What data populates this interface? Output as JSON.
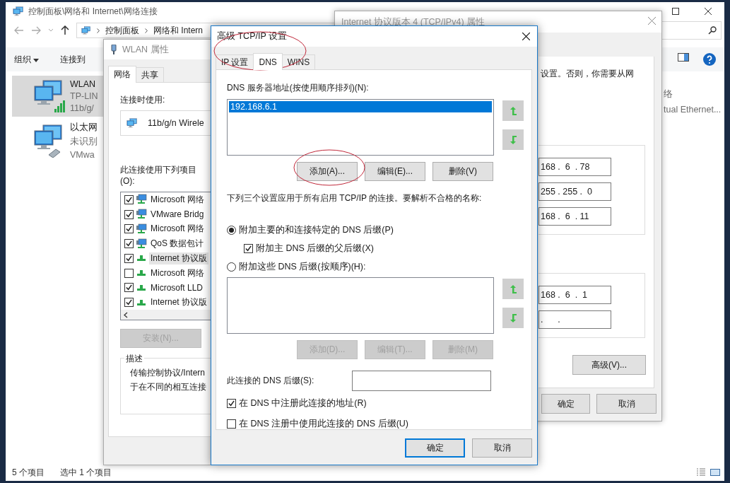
{
  "explorer": {
    "title": "控制面板\\网络和 Internet\\网络连接",
    "breadcrumb": [
      "控制面板",
      "网络和 Intern"
    ],
    "toolbar": [
      {
        "label": "组织",
        "dropdown": true
      },
      {
        "label": "连接到",
        "dropdown": false
      }
    ],
    "connections": [
      {
        "kind": "wireless",
        "selected": true,
        "lines": [
          "WLAN",
          "TP-LIN",
          "11b/g/"
        ]
      },
      {
        "kind": "wired",
        "selected": false,
        "lines": [
          "以太网",
          "未识别",
          "VMwa"
        ]
      }
    ],
    "partial_item": [
      "络",
      "tual Ethernet..."
    ],
    "status_bar": [
      "5 个项目",
      "选中 1 个项目"
    ]
  },
  "ipv4_window": {
    "title": "Internet 协议版本 4 (TCP/IPv4) 属性",
    "note": "设置。否则，你需要从网",
    "address_fields": [
      "168 .  6  . 78",
      "255 . 255 .  0",
      "168 .  6  . 11"
    ],
    "dns_fields": [
      "168 .  6  .  1",
      ".      ."
    ],
    "advanced_button": "高级(V)...",
    "buttons": [
      "确定",
      "取消"
    ]
  },
  "wlan_window": {
    "title": "WLAN 属性",
    "tabs": [
      {
        "label": "网络",
        "selected": true
      },
      {
        "label": "共享",
        "selected": false
      }
    ],
    "connect_using_label": "连接时使用:",
    "adapter": "11b/g/n  Wirele",
    "items_label": "此连接使用下列项目(O):",
    "items": [
      {
        "kind": "client",
        "label": "Microsoft 网络",
        "checked": true,
        "selected": false
      },
      {
        "kind": "client",
        "label": "VMware Bridg",
        "checked": true,
        "selected": false
      },
      {
        "kind": "client",
        "label": "Microsoft 网络",
        "checked": true,
        "selected": false
      },
      {
        "kind": "client",
        "label": "QoS 数据包计",
        "checked": true,
        "selected": false
      },
      {
        "kind": "protocol",
        "label": "Internet 协议版",
        "checked": true,
        "selected": true
      },
      {
        "kind": "protocol",
        "label": "Microsoft 网络",
        "checked": false,
        "selected": false
      },
      {
        "kind": "protocol",
        "label": "Microsoft LLD",
        "checked": true,
        "selected": false
      },
      {
        "kind": "protocol",
        "label": "Internet 协议版",
        "checked": true,
        "selected": false
      }
    ],
    "install_button": {
      "label": "安装(N)...",
      "disabled": true
    },
    "description_title": "描述",
    "description_lines": [
      "传输控制协议/Intern",
      "于在不同的相互连接"
    ]
  },
  "advanced_dialog": {
    "title": "高级 TCP/IP 设置",
    "tabs": [
      {
        "label": "IP 设置",
        "selected": false
      },
      {
        "label": "DNS",
        "selected": true
      },
      {
        "label": "WINS",
        "selected": false
      }
    ],
    "servers_label": "DNS 服务器地址(按使用顺序排列)(N):",
    "servers": [
      {
        "address": "192.168.6.1",
        "selected": true
      }
    ],
    "server_buttons": [
      {
        "label": "添加(A)...",
        "disabled": false
      },
      {
        "label": "编辑(E)...",
        "disabled": false
      },
      {
        "label": "删除(V)",
        "disabled": false
      }
    ],
    "info": "下列三个设置应用于所有启用 TCP/IP 的连接。要解析不合格的名称:",
    "suffix_options": [
      {
        "label": "附加主要的和连接特定的 DNS 后缀(P)",
        "selected": true
      },
      {
        "label": "附加这些 DNS 后缀(按顺序)(H):",
        "selected": false
      }
    ],
    "parent_suffix": {
      "label": "附加主 DNS 后缀的父后缀(X)",
      "checked": true
    },
    "suffix_buttons": [
      {
        "label": "添加(D)...",
        "disabled": true
      },
      {
        "label": "编辑(T)...",
        "disabled": true
      },
      {
        "label": "删除(M)",
        "disabled": true
      }
    ],
    "connection_suffix_label": "此连接的 DNS 后缀(S):",
    "register_options": [
      {
        "label": "在 DNS 中注册此连接的地址(R)",
        "checked": true
      },
      {
        "label": "在 DNS 注册中使用此连接的 DNS 后缀(U)",
        "checked": false
      }
    ],
    "buttons": [
      {
        "label": "确定",
        "default": true
      },
      {
        "label": "取消",
        "default": false
      }
    ]
  }
}
